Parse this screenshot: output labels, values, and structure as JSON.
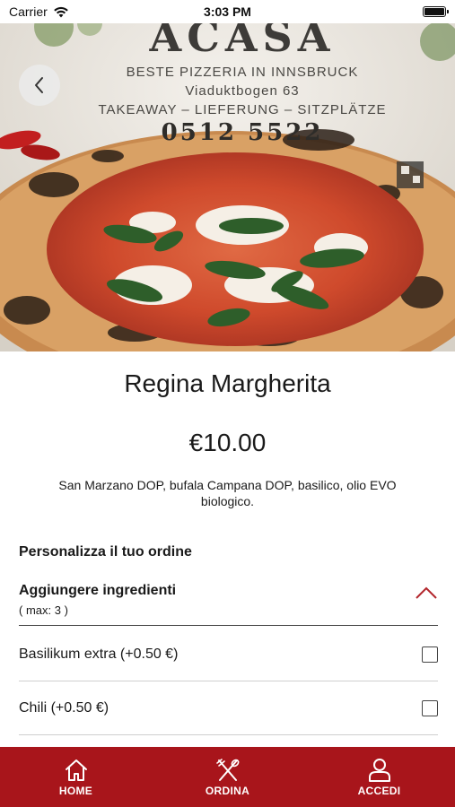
{
  "status_bar": {
    "carrier": "Carrier",
    "time": "3:03 PM"
  },
  "hero": {
    "image_alt": "pizza photo",
    "sign": {
      "logo": "ACASA",
      "line1": "BESTE PIZZERIA IN INNSBRUCK",
      "line2": "Viaduktbogen 63",
      "line3": "TAKEAWAY – LIEFERUNG – SITZPLÄTZE",
      "phone": "0512 5522"
    }
  },
  "product": {
    "title": "Regina Margherita",
    "price": "€10.00",
    "description": "San Marzano DOP, bufala Campana DOP, basilico, olio EVO biologico."
  },
  "customize": {
    "title": "Personalizza il tuo ordine",
    "section": {
      "title": "Aggiungere ingredienti",
      "subtitle": "( max: 3 )"
    },
    "options": [
      {
        "label": "Basilikum extra (+0.50 €)",
        "checked": false
      },
      {
        "label": "Chili (+0.50 €)",
        "checked": false
      }
    ]
  },
  "nav": {
    "items": [
      {
        "label": "HOME",
        "icon": "home-icon"
      },
      {
        "label": "ORDINA",
        "icon": "utensils-icon"
      },
      {
        "label": "ACCEDI",
        "icon": "user-icon"
      }
    ]
  },
  "colors": {
    "accent": "#a8151b",
    "chevron": "#b3262c"
  }
}
